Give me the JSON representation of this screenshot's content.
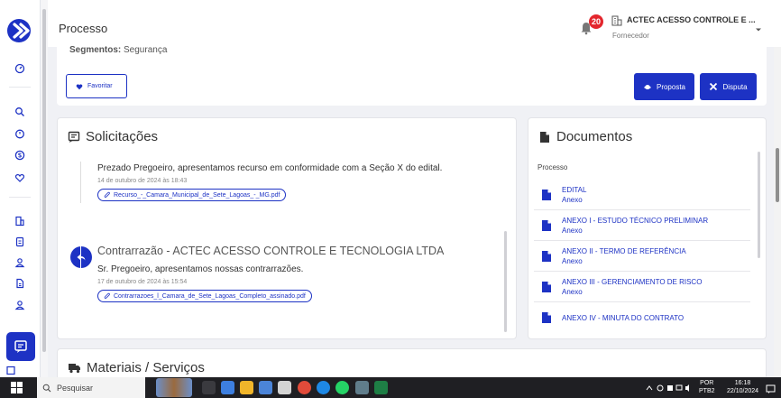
{
  "colors": {
    "accent": "#1d32c4",
    "badge": "#e3262d",
    "page_bg": "#f0f1f5",
    "taskbar": "#1f1f23"
  },
  "header": {
    "title": "Processo",
    "notification_count": "20",
    "company": "ACTEC ACESSO CONTROLE E ...",
    "role": "Fornecedor"
  },
  "top": {
    "segment_label": "Segmentos:",
    "segment_value": "Segurança",
    "favorite_label": "Favoritar",
    "proposal_label": "Proposta",
    "dispute_label": "Disputa"
  },
  "requests": {
    "title": "Solicitações",
    "items": [
      {
        "text": "Prezado Pregoeiro, apresentamos recurso em conformidade com a Seção X do edital.",
        "date": "14 de outubro de 2024 às 18:43",
        "attachment": "Recurso_-_Camara_Municipal_de_Sete_Lagoas_-_MG.pdf"
      },
      {
        "title": "Contrarrazão - ACTEC ACESSO CONTROLE E TECNOLOGIA LTDA",
        "text": "Sr. Pregoeiro, apresentamos nossas contrarrazões.",
        "date": "17 de outubro de 2024 às 15:54",
        "attachment": "Contrarrazoes_l_Camara_de_Sete_Lagoas_Completo_assinado.pdf"
      }
    ]
  },
  "documents": {
    "title": "Documentos",
    "section": "Processo",
    "items": [
      {
        "name": "EDITAL",
        "sub": "Anexo"
      },
      {
        "name": "ANEXO I - ESTUDO TÉCNICO PRELIMINAR",
        "sub": "Anexo"
      },
      {
        "name": "ANEXO II - TERMO DE REFERÊNCIA",
        "sub": "Anexo"
      },
      {
        "name": "ANEXO III - GERENCIAMENTO DE RISCO",
        "sub": "Anexo"
      },
      {
        "name": "ANEXO IV - MINUTA DO CONTRATO",
        "sub": ""
      }
    ]
  },
  "materials": {
    "title": "Materiais / Serviços"
  },
  "taskbar": {
    "search_placeholder": "Pesquisar",
    "lang_line1": "POR",
    "lang_line2": "PTB2",
    "time": "16:18",
    "date": "22/10/2024"
  },
  "icons": {
    "sidebar": [
      "dashboard-icon",
      "search-icon",
      "clock-icon",
      "dollar-icon",
      "heart-icon",
      "building-icon",
      "document-icon",
      "user-icon",
      "file-icon",
      "user-alt-icon"
    ]
  }
}
